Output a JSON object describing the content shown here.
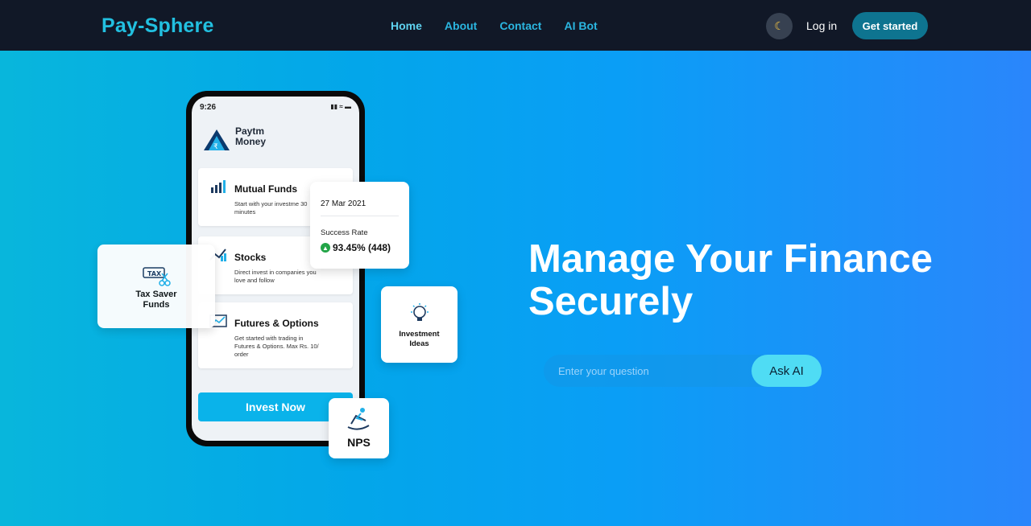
{
  "brand": "Pay-Sphere",
  "nav": {
    "links": [
      "Home",
      "About",
      "Contact",
      "AI Bot"
    ],
    "theme_icon": "moon-icon",
    "login": "Log in",
    "cta": "Get started"
  },
  "phone": {
    "time": "9:26",
    "app_name_line1": "Paytm",
    "app_name_line2": "Money",
    "cards": [
      {
        "title": "Mutual Funds",
        "desc": "Start with your investme 30 minutes",
        "icon": "bar-chart-icon"
      },
      {
        "title": "Stocks",
        "desc": "Direct invest in companies you love and follow",
        "icon": "stocks-icon"
      },
      {
        "title": "Futures & Options",
        "desc": "Get started with trading in Futures & Options. Max Rs. 10/ order",
        "icon": "trend-chart-icon"
      }
    ],
    "invest_button": "Invest Now"
  },
  "floating": {
    "tax_line1": "Tax Saver",
    "tax_line2": "Funds",
    "tax_badge": "TAX",
    "rate_date": "27 Mar 2021",
    "rate_label": "Success Rate",
    "rate_value": "93.45% (448)",
    "ideas_line1": "Investment",
    "ideas_line2": "Ideas",
    "nps": "NPS"
  },
  "hero": {
    "line1": "Manage Your Finance",
    "line2": "Securely",
    "ask_placeholder": "Enter your question",
    "ask_button": "Ask AI"
  },
  "colors": {
    "nav_bg": "#111827",
    "brand": "#22c0e0",
    "cta_bg": "#0e7490",
    "ask_button_bg": "#4fdcf4"
  }
}
